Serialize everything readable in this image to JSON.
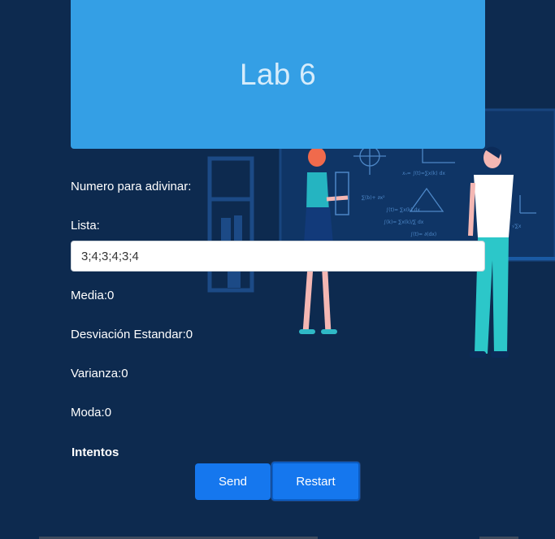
{
  "header": {
    "title": "Lab 6"
  },
  "form": {
    "guess_label": "Numero para adivinar:",
    "list_label": "Lista:",
    "list_value": "3;4;3;4;3;4"
  },
  "stats": {
    "mean": "Media:0",
    "std_dev": "Desviación Estandar:0",
    "variance": "Varianza:0",
    "mode": "Moda:0"
  },
  "attempts": {
    "title": "Intentos"
  },
  "actions": {
    "send_label": "Send",
    "restart_label": "Restart"
  },
  "colors": {
    "background": "#0d2a4f",
    "header_card": "#349fe5",
    "button": "#1577ee"
  }
}
